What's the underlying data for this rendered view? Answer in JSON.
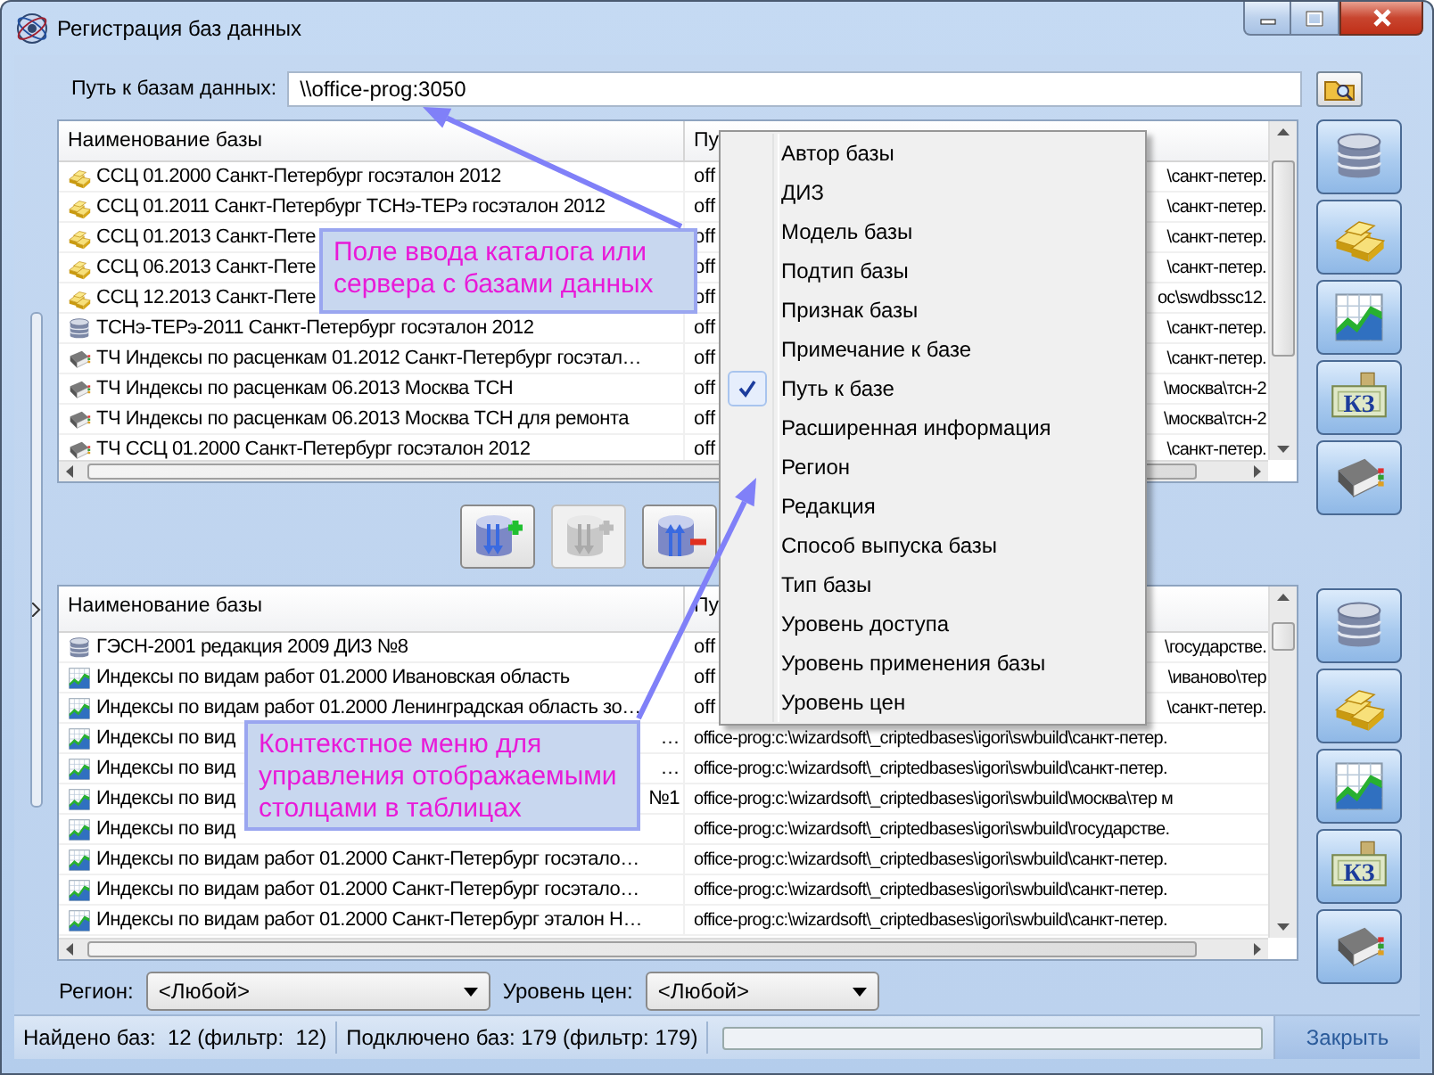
{
  "window": {
    "title": "Регистрация баз данных"
  },
  "path_field": {
    "label": "Путь к базам данных:",
    "value": "\\\\office-prog:3050"
  },
  "top_table": {
    "columns": [
      "Наименование базы",
      "Пу"
    ],
    "rows": [
      {
        "kind": "ingots",
        "name": "ССЦ 01.2000 Санкт-Петербург госэталон 2012",
        "path_head": "off",
        "path_tail": "\\санкт-петер."
      },
      {
        "kind": "ingots",
        "name": "ССЦ 01.2011 Санкт-Петербург ТСНэ-ТЕРэ госэталон 2012",
        "path_head": "off",
        "path_tail": "\\санкт-петер."
      },
      {
        "kind": "ingots",
        "name": "ССЦ 01.2013 Санкт-Пете",
        "path_head": "off",
        "path_tail": "\\санкт-петер."
      },
      {
        "kind": "ingots",
        "name": "ССЦ 06.2013 Санкт-Пете",
        "path_head": "off",
        "path_tail": "\\санкт-петер."
      },
      {
        "kind": "ingots",
        "name": "ССЦ 12.2013 Санкт-Пете",
        "path_head": "off",
        "path_tail": "oc\\swdbssc12."
      },
      {
        "kind": "database",
        "name": "ТСНэ-ТЕРэ-2011 Санкт-Петербург госэталон 2012",
        "path_head": "off",
        "path_tail": "\\санкт-петер."
      },
      {
        "kind": "book",
        "name": "ТЧ Индексы по расценкам 01.2012 Санкт-Петербург госэтал…",
        "path_head": "off",
        "path_tail": "\\санкт-петер."
      },
      {
        "kind": "book",
        "name": "ТЧ Индексы по расценкам 06.2013 Москва ТСН",
        "path_head": "off",
        "path_tail": "\\москва\\тсн-2"
      },
      {
        "kind": "book",
        "name": "ТЧ Индексы по расценкам 06.2013 Москва ТСН для ремонта",
        "path_head": "off",
        "path_tail": "\\москва\\тсн-2"
      },
      {
        "kind": "book",
        "name": "ТЧ ССЦ 01.2000 Санкт-Петербург госэталон 2012",
        "path_head": "off",
        "path_tail": "\\санкт-петер."
      }
    ]
  },
  "middle_buttons": [
    {
      "kind": "add",
      "disabled": false
    },
    {
      "kind": "add",
      "disabled": true
    },
    {
      "kind": "remove",
      "disabled": false
    }
  ],
  "bottom_table": {
    "columns": [
      "Наименование базы",
      "Пу"
    ],
    "rows": [
      {
        "kind": "database",
        "name": "ГЭСН-2001 редакция 2009 ДИЗ №8",
        "path_head": "off",
        "path_tail": "\\государстве."
      },
      {
        "kind": "chart",
        "name": "Индексы по видам работ 01.2000 Ивановская область",
        "path_head": "off",
        "path_tail": "\\иваново\\тер"
      },
      {
        "kind": "chart",
        "name": "Индексы по видам работ 01.2000 Ленинградская область зо…",
        "path_head": "off",
        "path_tail": "\\санкт-петер."
      },
      {
        "kind": "chart",
        "name": "Индексы по вид",
        "name_tail": "…",
        "path": "office-prog:c:\\wizardsoft\\_criptedbases\\igori\\swbuild\\санкт-петер."
      },
      {
        "kind": "chart",
        "name": "Индексы по вид",
        "name_tail": "…",
        "path": "office-prog:c:\\wizardsoft\\_criptedbases\\igori\\swbuild\\санкт-петер."
      },
      {
        "kind": "chart",
        "name": "Индексы по вид",
        "name_tail": "№1",
        "path": "office-prog:c:\\wizardsoft\\_criptedbases\\igori\\swbuild\\москва\\тер м"
      },
      {
        "kind": "chart",
        "name": "Индексы по вид",
        "path": "office-prog:c:\\wizardsoft\\_criptedbases\\igori\\swbuild\\государстве."
      },
      {
        "kind": "chart",
        "name": "Индексы по видам работ 01.2000 Санкт-Петербург госэтало…",
        "path": "office-prog:c:\\wizardsoft\\_criptedbases\\igori\\swbuild\\санкт-петер."
      },
      {
        "kind": "chart",
        "name": "Индексы по видам работ 01.2000 Санкт-Петербург госэтало…",
        "path": "office-prog:c:\\wizardsoft\\_criptedbases\\igori\\swbuild\\санкт-петер."
      },
      {
        "kind": "chart",
        "name": "Индексы по видам работ 01.2000 Санкт-Петербург эталон Н…",
        "path": "office-prog:c:\\wizardsoft\\_criptedbases\\igori\\swbuild\\санкт-петер."
      }
    ]
  },
  "top_tools": [
    {
      "kind": "database"
    },
    {
      "kind": "ingots"
    },
    {
      "kind": "chart"
    },
    {
      "kind": "banknote",
      "label": "КЗ"
    },
    {
      "kind": "book"
    }
  ],
  "bottom_tools": [
    {
      "kind": "database"
    },
    {
      "kind": "ingots"
    },
    {
      "kind": "chart"
    },
    {
      "kind": "banknote",
      "label": "КЗ"
    },
    {
      "kind": "book"
    }
  ],
  "filters": [
    {
      "label": "Регион:",
      "value": "<Любой>"
    },
    {
      "label": "Уровень цен:",
      "value": "<Любой>"
    }
  ],
  "status_bar": {
    "found": "Найдено баз:  12 (фильтр:  12)",
    "connected": "Подключено баз: 179 (фильтр: 179)",
    "progress": {
      "level": 0
    },
    "close_button": "Закрыть"
  },
  "context_menu": {
    "items": [
      {
        "label": "Автор базы",
        "checked": false
      },
      {
        "label": "ДИЗ",
        "checked": false
      },
      {
        "label": "Модель базы",
        "checked": false
      },
      {
        "label": "Подтип базы",
        "checked": false
      },
      {
        "label": "Признак базы",
        "checked": false
      },
      {
        "label": "Примечание к базе",
        "checked": false
      },
      {
        "label": "Путь к базе",
        "checked": true
      },
      {
        "label": "Расширенная информация",
        "checked": false
      },
      {
        "label": "Регион",
        "checked": false
      },
      {
        "label": "Редакция",
        "checked": false
      },
      {
        "label": "Способ выпуска базы",
        "checked": false
      },
      {
        "label": "Тип базы",
        "checked": false
      },
      {
        "label": "Уровень доступа",
        "checked": false
      },
      {
        "label": "Уровень применения базы",
        "checked": false
      },
      {
        "label": "Уровень цен",
        "checked": false
      }
    ]
  },
  "callouts": [
    {
      "text": "Поле ввода каталога или сервера с базами данных"
    },
    {
      "text": "Контекстное меню для управления отображаемыми столцами в таблицах"
    }
  ]
}
